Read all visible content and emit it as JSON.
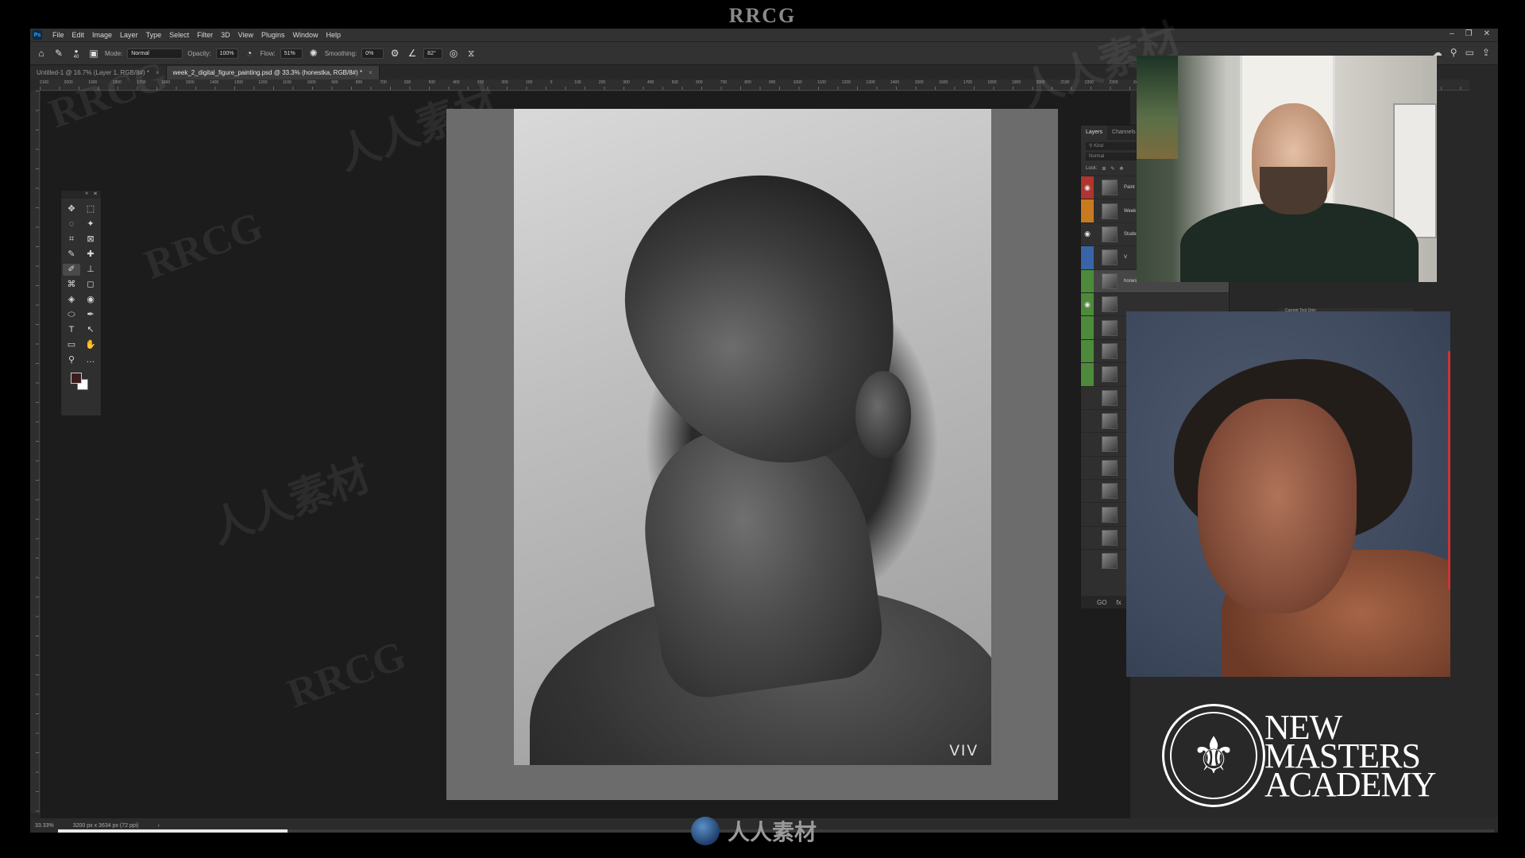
{
  "watermark": {
    "top": "RRCG",
    "bottom": "人人素材",
    "tiles": [
      "RRCG",
      "人人素材",
      "RRCG",
      "人人素材",
      "RRCG",
      "人人素材",
      "RRCG",
      "人人素材",
      "RRCG",
      "人人素材",
      "RRCG",
      "人人素材"
    ]
  },
  "app": {
    "logo": "Ps"
  },
  "menu": [
    "File",
    "Edit",
    "Image",
    "Layer",
    "Type",
    "Select",
    "Filter",
    "3D",
    "View",
    "Plugins",
    "Window",
    "Help"
  ],
  "window_controls": [
    "–",
    "❐",
    "✕"
  ],
  "options_bar": {
    "brush_size": "40",
    "mode_label": "Mode:",
    "mode_value": "Normal",
    "opacity_label": "Opacity:",
    "opacity_value": "100%",
    "flow_label": "Flow:",
    "flow_value": "51%",
    "smoothing_label": "Smoothing:",
    "smoothing_value": "0%",
    "angle_value": "82°"
  },
  "tabs": [
    {
      "label": "Untitled-1 @ 16.7% (Layer 1, RGB/8#) *",
      "active": false
    },
    {
      "label": "week_2_digital_figure_painting.psd @ 33.3% (honestka, RGB/8#) *",
      "active": true
    }
  ],
  "ruler_labels": [
    "2100",
    "2000",
    "1900",
    "1800",
    "1700",
    "1600",
    "1500",
    "1400",
    "1300",
    "1200",
    "1100",
    "1000",
    "900",
    "800",
    "700",
    "600",
    "500",
    "400",
    "300",
    "200",
    "100",
    "0",
    "100",
    "200",
    "300",
    "400",
    "500",
    "600",
    "700",
    "800",
    "900",
    "1000",
    "1100",
    "1200",
    "1300",
    "1400",
    "1500",
    "1600",
    "1700",
    "1800",
    "1900",
    "2000",
    "2100",
    "2200",
    "2300",
    "2400",
    "2500",
    "2600",
    "2700",
    "2800",
    "2900",
    "3000",
    "3100",
    "3200",
    "3300",
    "3400",
    "3500"
  ],
  "tools": [
    "✥",
    "⬚",
    "◌",
    "✦",
    "⌗",
    "⊠",
    "✎",
    "✚",
    "✐",
    "⊥",
    "⌘",
    "◻",
    "◈",
    "◉",
    "⬭",
    "✒",
    "T",
    "↖",
    "▭",
    "✋",
    "⚲",
    "…"
  ],
  "painting": {
    "signature": "VIV"
  },
  "layers_panel": {
    "tabs": [
      "Layers",
      "Channels"
    ],
    "kind_label": "Kind",
    "blend": "Normal",
    "lock_label": "Lock:",
    "layers": [
      {
        "name": "Paint",
        "color": "#b0352f",
        "eye": true
      },
      {
        "name": "Week",
        "color": "#c77a1e",
        "eye": false
      },
      {
        "name": "Stude",
        "color": "",
        "eye": true
      },
      {
        "name": "V",
        "color": "#3a64a8",
        "eye": false
      },
      {
        "name": "honestka",
        "color": "#4d8a3a",
        "eye": false,
        "selected": true
      },
      {
        "name": "",
        "color": "#4d8a3a",
        "eye": true
      },
      {
        "name": "",
        "color": "#4d8a3a",
        "eye": false
      },
      {
        "name": "",
        "color": "#4d8a3a",
        "eye": false
      },
      {
        "name": "",
        "color": "#4d8a3a",
        "eye": false
      },
      {
        "name": "",
        "color": "",
        "eye": false
      },
      {
        "name": "",
        "color": "",
        "eye": false
      },
      {
        "name": "",
        "color": "",
        "eye": false
      },
      {
        "name": "",
        "color": "",
        "eye": false
      },
      {
        "name": "",
        "color": "",
        "eye": false
      },
      {
        "name": "",
        "color": "",
        "eye": false
      },
      {
        "name": "",
        "color": "",
        "eye": false
      },
      {
        "name": "",
        "color": "",
        "eye": false
      }
    ],
    "footer": [
      "GO",
      "fx"
    ]
  },
  "hidden_panel_labels": [
    "Current Tool Only"
  ],
  "brand": {
    "line1": "NEW",
    "line2": "MASTERS",
    "line3": "ACADEMY",
    "emblem": "⚜"
  },
  "status": {
    "zoom": "33.33%",
    "doc_size": "3200 px x 3634 px (72 ppi)",
    "arrow": "›",
    "progress": 0.16
  }
}
